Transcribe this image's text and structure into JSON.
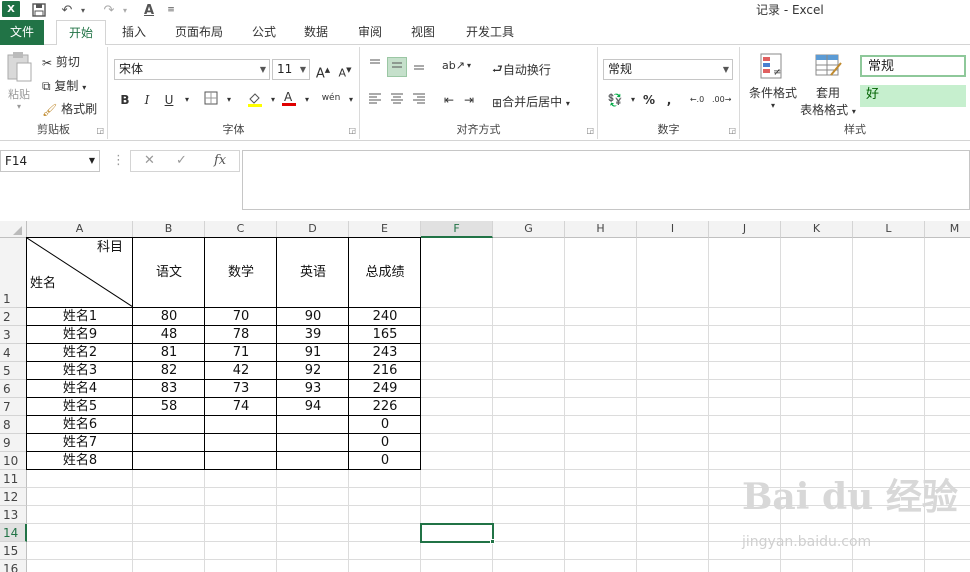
{
  "window": {
    "title": "记录 - Excel"
  },
  "tabs": [
    "文件",
    "开始",
    "插入",
    "页面布局",
    "公式",
    "数据",
    "审阅",
    "视图",
    "开发工具"
  ],
  "ribbon": {
    "clipboard": {
      "paste": "粘贴",
      "cut": "剪切",
      "copy": "复制",
      "painter": "格式刷",
      "label": "剪贴板"
    },
    "font": {
      "name": "宋体",
      "size": "11",
      "bold": "B",
      "italic": "I",
      "underline": "U",
      "label": "字体",
      "grow": "A",
      "shrink": "A",
      "phonetic": "wén"
    },
    "alignment": {
      "wrap": "自动换行",
      "merge": "合并后居中",
      "label": "对齐方式"
    },
    "number": {
      "format": "常规",
      "percent": "%",
      "comma": ",",
      "label": "数字"
    },
    "styles": {
      "conditional": "条件格式",
      "table_fmt_1": "套用",
      "table_fmt_2": "表格格式",
      "normal": "常规",
      "good": "好",
      "label": "样式"
    }
  },
  "formula_bar": {
    "name_box": "F14",
    "fx": "fx"
  },
  "columns": [
    "A",
    "B",
    "C",
    "D",
    "E",
    "F",
    "G",
    "H",
    "I",
    "J",
    "K",
    "L",
    "M"
  ],
  "rows": [
    "1",
    "2",
    "3",
    "4",
    "5",
    "6",
    "7",
    "8",
    "9",
    "10",
    "11",
    "12",
    "13",
    "14",
    "15",
    "16"
  ],
  "sheet": {
    "header_top": "科目",
    "header_bottom": "姓名",
    "subjects": [
      "语文",
      "数学",
      "英语",
      "总成绩"
    ],
    "records": [
      {
        "name": "姓名1",
        "chinese": "80",
        "math": "70",
        "english": "90",
        "total": "240"
      },
      {
        "name": "姓名9",
        "chinese": "48",
        "math": "78",
        "english": "39",
        "total": "165"
      },
      {
        "name": "姓名2",
        "chinese": "81",
        "math": "71",
        "english": "91",
        "total": "243"
      },
      {
        "name": "姓名3",
        "chinese": "82",
        "math": "42",
        "english": "92",
        "total": "216"
      },
      {
        "name": "姓名4",
        "chinese": "83",
        "math": "73",
        "english": "93",
        "total": "249"
      },
      {
        "name": "姓名5",
        "chinese": "58",
        "math": "74",
        "english": "94",
        "total": "226"
      },
      {
        "name": "姓名6",
        "chinese": "",
        "math": "",
        "english": "",
        "total": "0"
      },
      {
        "name": "姓名7",
        "chinese": "",
        "math": "",
        "english": "",
        "total": "0"
      },
      {
        "name": "姓名8",
        "chinese": "",
        "math": "",
        "english": "",
        "total": "0"
      }
    ]
  },
  "watermark": {
    "brand": "Bai du 经验",
    "url": "jingyan.baidu.com"
  },
  "colors": {
    "accent": "#217346",
    "good_fill": "#c6efce"
  }
}
